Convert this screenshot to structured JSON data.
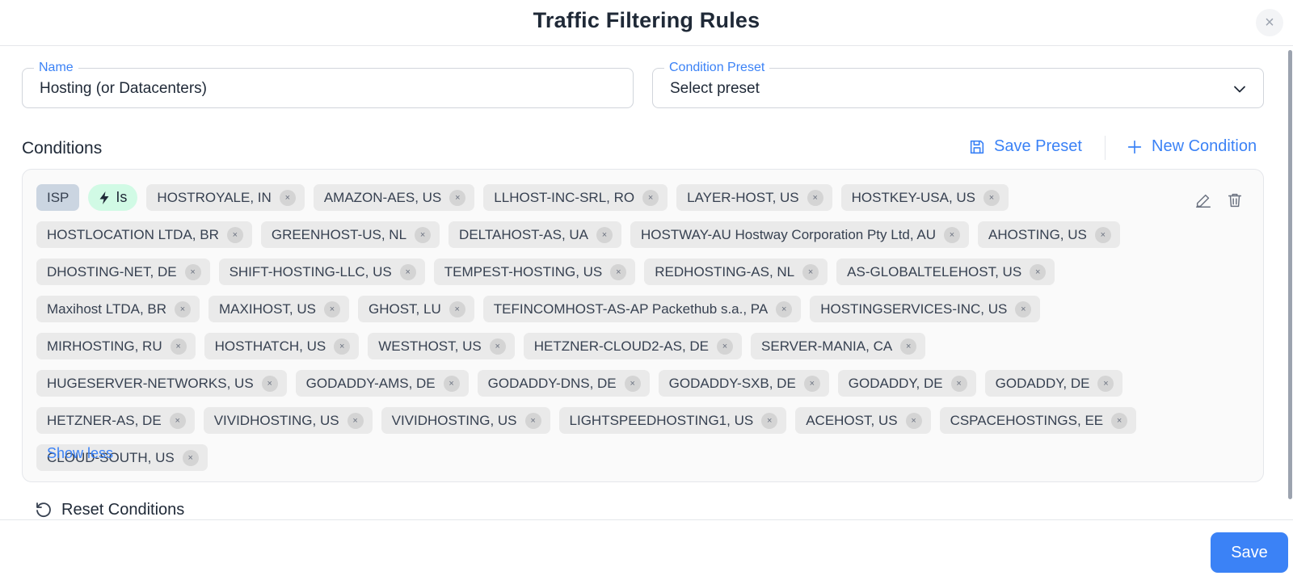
{
  "modal": {
    "title": "Traffic Filtering Rules",
    "close_glyph": "×"
  },
  "name_field": {
    "label": "Name",
    "value": "Hosting (or Datacenters)"
  },
  "preset_field": {
    "label": "Condition Preset",
    "value": "Select preset"
  },
  "conditions": {
    "title": "Conditions",
    "save_preset_label": "Save Preset",
    "new_condition_label": "New Condition",
    "field_tag": "ISP",
    "operator_tag": "Is",
    "remove_glyph": "×",
    "values": [
      "HOSTROYALE, IN",
      "AMAZON-AES, US",
      "LLHOST-INC-SRL, RO",
      "LAYER-HOST, US",
      "HOSTKEY-USA, US",
      "HOSTLOCATION LTDA, BR",
      "GREENHOST-US, NL",
      "DELTAHOST-AS, UA",
      "HOSTWAY-AU Hostway Corporation Pty Ltd, AU",
      "AHOSTING, US",
      "DHOSTING-NET, DE",
      "SHIFT-HOSTING-LLC, US",
      "TEMPEST-HOSTING, US",
      "REDHOSTING-AS, NL",
      "AS-GLOBALTELEHOST, US",
      "Maxihost LTDA, BR",
      "MAXIHOST, US",
      "GHOST, LU",
      "TEFINCOMHOST-AS-AP Packethub s.a., PA",
      "HOSTINGSERVICES-INC, US",
      "MIRHOSTING, RU",
      "HOSTHATCH, US",
      "WESTHOST, US",
      "HETZNER-CLOUD2-AS, DE",
      "SERVER-MANIA, CA",
      "HUGESERVER-NETWORKS, US",
      "GODADDY-AMS, DE",
      "GODADDY-DNS, DE",
      "GODADDY-SXB, DE",
      "GODADDY, DE",
      "GODADDY, DE",
      "HETZNER-AS, DE",
      "VIVIDHOSTING, US",
      "VIVIDHOSTING, US",
      "LIGHTSPEEDHOSTING1, US",
      "ACEHOST, US",
      "CSPACEHOSTINGS, EE",
      "CLOUD-SOUTH, US"
    ],
    "show_less_label": "Show less"
  },
  "reset_label": "Reset Conditions",
  "footer": {
    "save_label": "Save"
  },
  "colors": {
    "accent": "#3b82f6",
    "operator_bg": "#d1fae5",
    "field_tag_bg": "#cbd5e1",
    "chip_bg": "#eaeaea"
  },
  "icons": {
    "save_preset": "floppy-disk-icon",
    "new_condition": "plus-icon",
    "operator": "lightning-bolt-icon",
    "edit": "pencil-icon",
    "delete": "trash-icon",
    "reset": "rotate-ccw-icon",
    "close": "close-icon",
    "dropdown": "chevron-down-icon"
  }
}
